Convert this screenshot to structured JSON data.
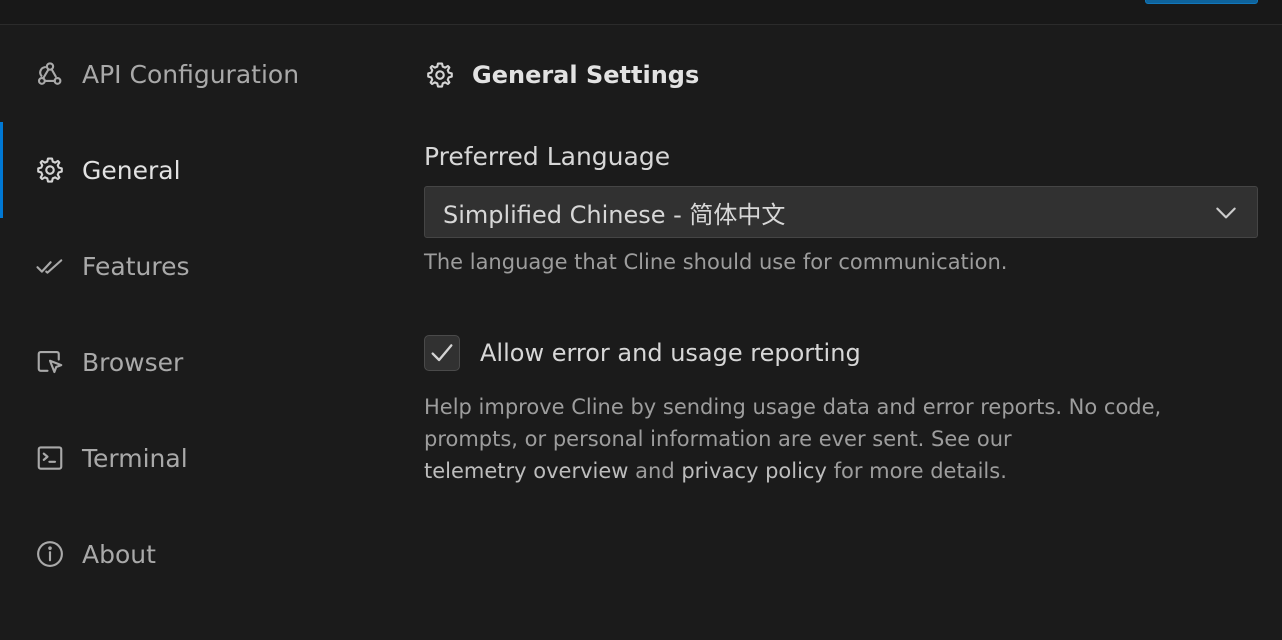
{
  "sidebar": {
    "items": [
      {
        "label": "API Configuration",
        "icon": "webhook-icon",
        "active": false
      },
      {
        "label": "General",
        "icon": "gear-icon",
        "active": true
      },
      {
        "label": "Features",
        "icon": "check-all-icon",
        "active": false
      },
      {
        "label": "Browser",
        "icon": "browser-cursor-icon",
        "active": false
      },
      {
        "label": "Terminal",
        "icon": "terminal-icon",
        "active": false
      },
      {
        "label": "About",
        "icon": "info-icon",
        "active": false
      }
    ]
  },
  "main": {
    "section_title": "General Settings",
    "language": {
      "label": "Preferred Language",
      "selected": "Simplified Chinese - 简体中文",
      "helper": "The language that Cline should use for communication."
    },
    "telemetry": {
      "checked": true,
      "label": "Allow error and usage reporting",
      "helper_line1": "Help improve Cline by sending usage data and error reports. No code,",
      "helper_line2": "prompts, or personal information are ever sent. See our",
      "link_overview": "telemetry overview",
      "and": "and",
      "link_privacy": "privacy policy",
      "helper_end": "for more details."
    }
  },
  "colors": {
    "background": "#1b1b1b",
    "accent": "#0078d4",
    "input_bg": "#313131"
  }
}
